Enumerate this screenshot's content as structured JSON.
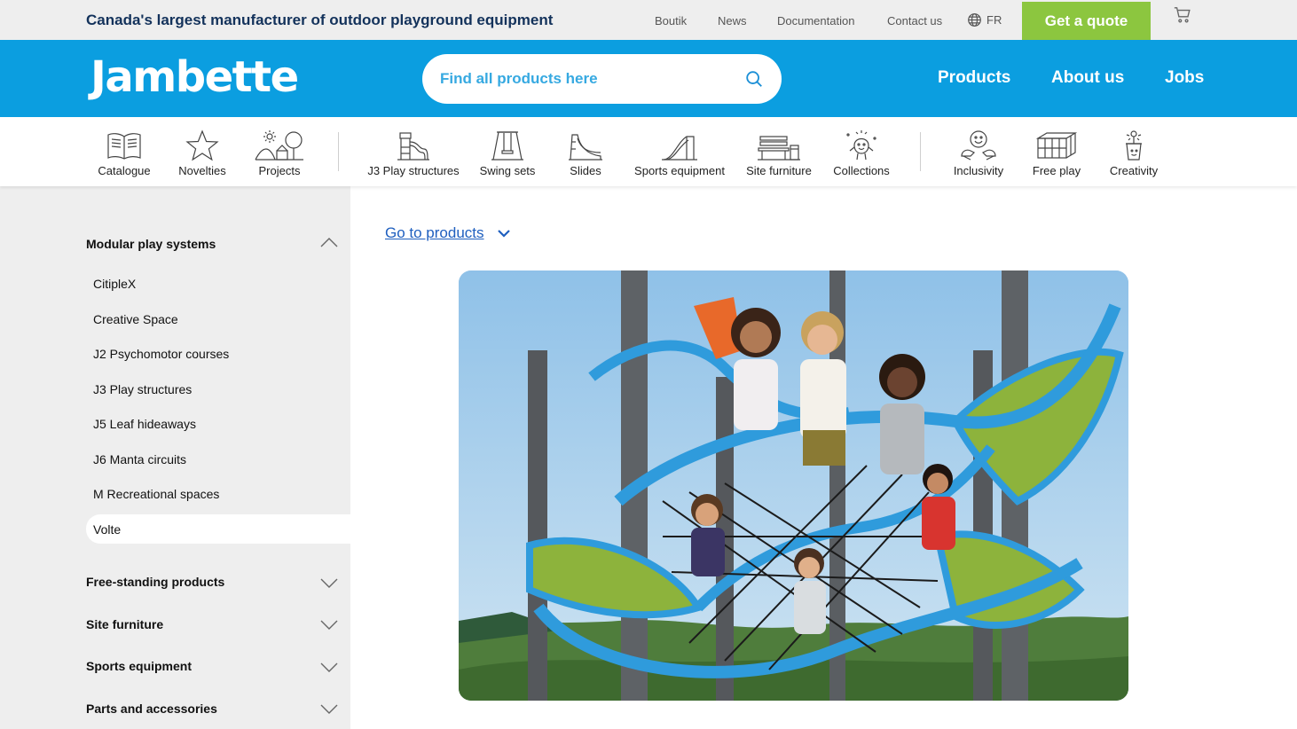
{
  "topbar": {
    "tagline": "Canada's largest manufacturer of outdoor playground equipment",
    "links": [
      "Boutik",
      "News",
      "Documentation",
      "Contact us"
    ],
    "lang": "FR",
    "quote_label": "Get a quote"
  },
  "header": {
    "logo": "Jambette",
    "search_placeholder": "Find all products here",
    "nav": [
      "Products",
      "About us",
      "Jobs"
    ]
  },
  "categories": [
    {
      "label": "Catalogue",
      "icon": "book-icon"
    },
    {
      "label": "Novelties",
      "icon": "star-icon"
    },
    {
      "label": "Projects",
      "icon": "park-scene-icon"
    },
    {
      "label": "J3 Play structures",
      "icon": "play-structure-icon"
    },
    {
      "label": "Swing sets",
      "icon": "swing-icon"
    },
    {
      "label": "Slides",
      "icon": "slide-icon"
    },
    {
      "label": "Sports equipment",
      "icon": "ramp-icon"
    },
    {
      "label": "Site furniture",
      "icon": "bench-icon"
    },
    {
      "label": "Collections",
      "icon": "character-icon"
    },
    {
      "label": "Inclusivity",
      "icon": "smiley-hands-icon"
    },
    {
      "label": "Free play",
      "icon": "cube-frame-icon"
    },
    {
      "label": "Creativity",
      "icon": "flower-pot-icon"
    }
  ],
  "sidebar": {
    "expanded_title": "Modular play systems",
    "items": [
      "CitipleX",
      "Creative Space",
      "J2 Psychomotor courses",
      "J3 Play structures",
      "J5 Leaf hideaways",
      "J6 Manta circuits",
      "M Recreational spaces"
    ],
    "active_item": "Volte",
    "collapsed": [
      "Free-standing products",
      "Site furniture",
      "Sports equipment",
      "Parts and accessories"
    ]
  },
  "main": {
    "goto_label": "Go to products"
  },
  "colors": {
    "brand_blue": "#0b9ee0",
    "quote_green": "#8cc63f",
    "tagline_navy": "#13325b",
    "link_blue": "#1f5fbf"
  }
}
